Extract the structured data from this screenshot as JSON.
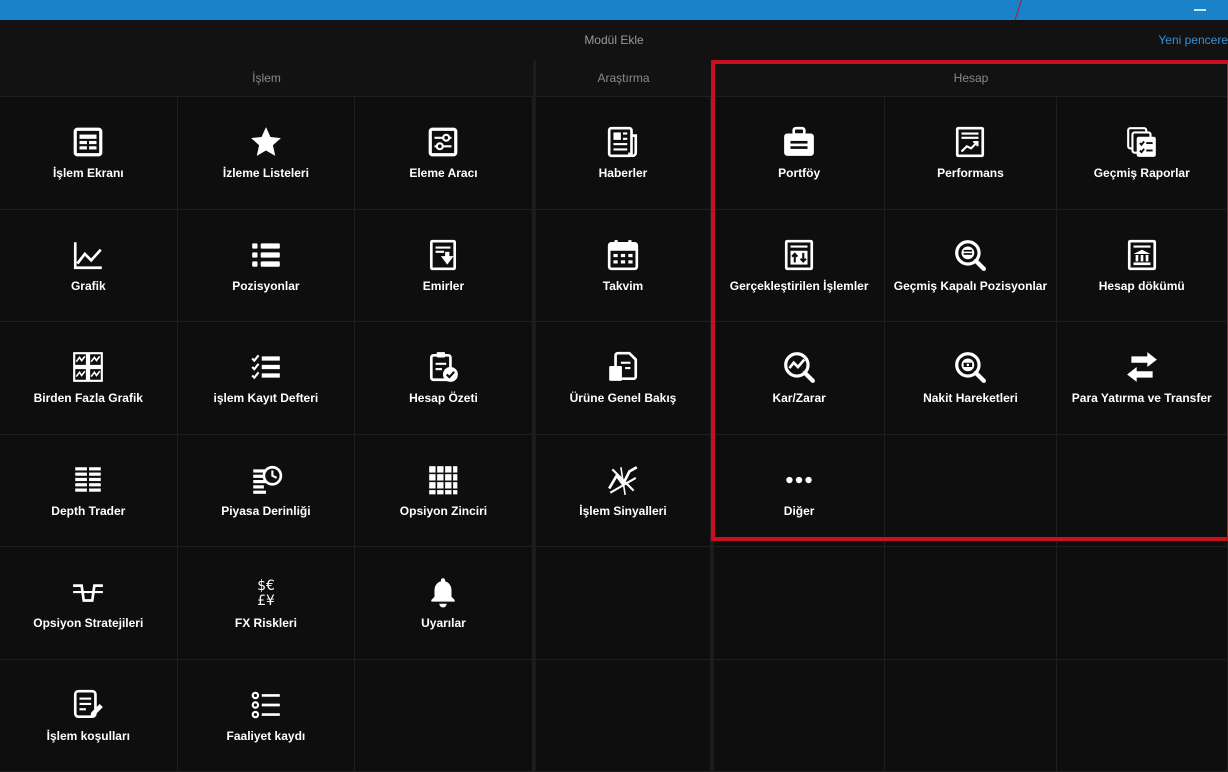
{
  "window": {
    "title": "Modül Ekle",
    "new_window": "Yeni pencere"
  },
  "sections": [
    {
      "id": "islem",
      "title": "İşlem"
    },
    {
      "id": "arastirma",
      "title": "Araştırma"
    },
    {
      "id": "hesap",
      "title": "Hesap"
    }
  ],
  "islem": [
    {
      "label": "İşlem Ekranı",
      "icon": "trading-screen-icon"
    },
    {
      "label": "İzleme Listeleri",
      "icon": "star-icon"
    },
    {
      "label": "Eleme Aracı",
      "icon": "filter-sliders-icon"
    },
    {
      "label": "Grafik",
      "icon": "line-chart-icon"
    },
    {
      "label": "Pozisyonlar",
      "icon": "list-icon"
    },
    {
      "label": "Emirler",
      "icon": "orders-icon"
    },
    {
      "label": "Birden Fazla Grafik",
      "icon": "multi-chart-icon"
    },
    {
      "label": "işlem Kayıt Defteri",
      "icon": "checklist-icon"
    },
    {
      "label": "Hesap Özeti",
      "icon": "clipboard-check-icon"
    },
    {
      "label": "Depth Trader",
      "icon": "depth-table-icon"
    },
    {
      "label": "Piyasa Derinliği",
      "icon": "market-depth-clock-icon"
    },
    {
      "label": "Opsiyon Zinciri",
      "icon": "grid-icon"
    },
    {
      "label": "Opsiyon Stratejileri",
      "icon": "option-strategy-icon"
    },
    {
      "label": "FX Riskleri",
      "icon": "currency-icon"
    },
    {
      "label": "Uyarılar",
      "icon": "bell-icon"
    },
    {
      "label": "İşlem koşulları",
      "icon": "document-edit-icon"
    },
    {
      "label": "Faaliyet kaydı",
      "icon": "bullet-list-icon"
    }
  ],
  "arastirma": [
    {
      "label": "Haberler",
      "icon": "news-icon"
    },
    {
      "label": "Takvim",
      "icon": "calendar-icon"
    },
    {
      "label": "Ürüne Genel Bakış",
      "icon": "document-icon"
    },
    {
      "label": "İşlem Sinyalleri",
      "icon": "signals-icon"
    }
  ],
  "hesap": [
    {
      "label": "Portföy",
      "icon": "briefcase-icon"
    },
    {
      "label": "Performans",
      "icon": "performance-icon"
    },
    {
      "label": "Geçmiş Raporlar",
      "icon": "reports-icon"
    },
    {
      "label": "Gerçekleştirilen İşlemler",
      "icon": "executed-trades-icon"
    },
    {
      "label": "Geçmiş Kapalı Pozisyonlar",
      "icon": "search-list-icon"
    },
    {
      "label": "Hesap dökümü",
      "icon": "bank-statement-icon"
    },
    {
      "label": "Kar/Zarar",
      "icon": "search-chart-icon"
    },
    {
      "label": "Nakit Hareketleri",
      "icon": "search-cash-icon"
    },
    {
      "label": "Para Yatırma ve Transfer",
      "icon": "transfer-arrows-icon"
    },
    {
      "label": "Diğer",
      "icon": "more-icon"
    }
  ],
  "colors": {
    "accent_blue": "#1a82c8",
    "link_blue": "#3a8fd6",
    "highlight_red": "#c8101e",
    "background": "#0e0e0e"
  }
}
